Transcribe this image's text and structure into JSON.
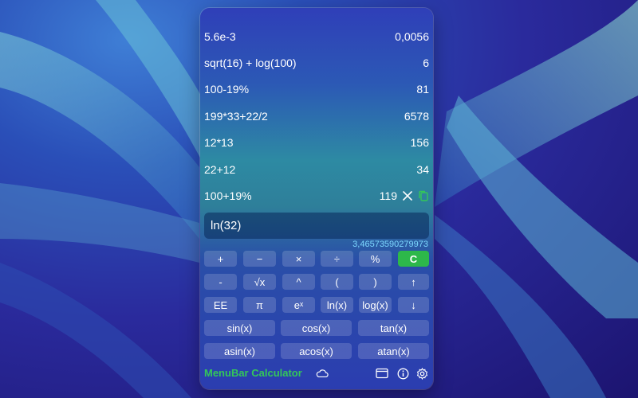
{
  "history": [
    {
      "expr": "5.6e-3",
      "result": "0,0056"
    },
    {
      "expr": "sqrt(16) + log(100)",
      "result": "6"
    },
    {
      "expr": "100-19%",
      "result": "81"
    },
    {
      "expr": "199*33+22/2",
      "result": "6578"
    },
    {
      "expr": "12*13",
      "result": "156"
    },
    {
      "expr": "22+12",
      "result": "34"
    },
    {
      "expr": "100+19%",
      "result": "119"
    }
  ],
  "input": {
    "value": "ln(32)"
  },
  "preview": "3,46573590279973",
  "keys": {
    "row1": [
      "+",
      "−",
      "×",
      "÷",
      "%",
      "C"
    ],
    "row2": [
      "-",
      "√x",
      "^",
      "(",
      ")",
      "↑"
    ],
    "row3": [
      "EE",
      "π",
      "eˣ",
      "ln(x)",
      "log(x)",
      "↓"
    ],
    "row4": [
      "sin(x)",
      "cos(x)",
      "tan(x)"
    ],
    "row5": [
      "asin(x)",
      "acos(x)",
      "atan(x)"
    ]
  },
  "footer": {
    "title": "MenuBar Calculator"
  },
  "colors": {
    "accent": "#34c759",
    "preview": "#7dd8ff"
  }
}
